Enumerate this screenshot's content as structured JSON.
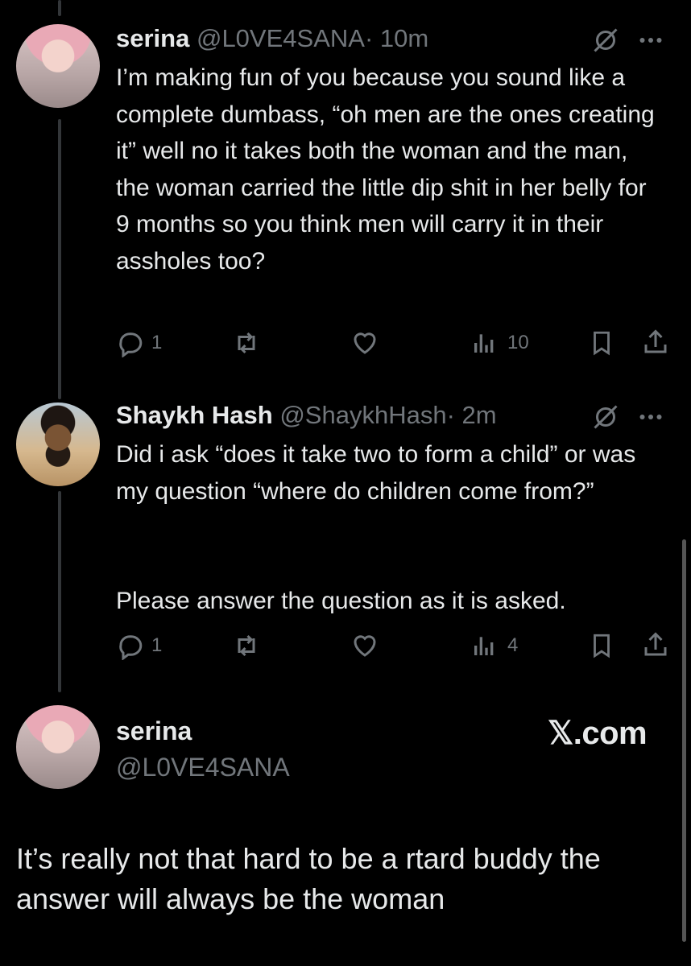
{
  "tweet1": {
    "name": "serina",
    "handle": "@L0VE4SANA",
    "time": "· 10m",
    "text": "I’m making fun of you because you sound like a complete dumbass, “oh men are the ones creating it” well no it takes both the woman and the man, the woman carried the little dip shit in her belly for 9 months so you think men will carry it in their assholes too?",
    "replies": "1",
    "views": "10"
  },
  "tweet2": {
    "name": "Shaykh Hash",
    "handle": "@ShaykhHash",
    "time": "· 2m",
    "text_p1": "Did i ask “does it take two to form a child” or was my question “where do children come from?”",
    "text_p2": "Please answer the question as it is asked.",
    "replies": "1",
    "views": "4"
  },
  "tweet3": {
    "name": "serina",
    "handle": "@L0VE4SANA",
    "text": "It’s really not that hard to be a rtard buddy the answer will always be the woman"
  },
  "watermark": "𝕏.com",
  "icons": {
    "reply": "reply-icon",
    "retweet": "retweet-icon",
    "like": "heart-icon",
    "views": "views-chart-icon",
    "bookmark": "bookmark-icon",
    "share": "share-icon",
    "grok": "grok-icon",
    "more": "more-icon"
  },
  "colors": {
    "background": "#000000",
    "text": "#e7e9ea",
    "muted": "#71767b"
  }
}
